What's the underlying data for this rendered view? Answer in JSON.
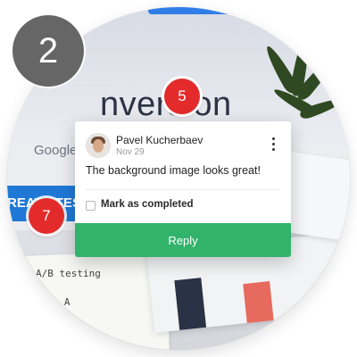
{
  "step_badge": "2",
  "markers": {
    "active": "5",
    "other": "7"
  },
  "background": {
    "headline": "nversion",
    "subtext": "Google Play.",
    "cta_fragment": "REATE TEST",
    "note_line1": "A/B testing",
    "note_line2": "ce A"
  },
  "comment_card": {
    "author": "Pavel Kucherbaev",
    "date": "Nov 29",
    "text": "The background image looks great!",
    "mark_completed_label": "Mark as completed",
    "reply_label": "Reply"
  },
  "colors": {
    "accent_green": "#31b36b",
    "marker_red": "#e32b2b",
    "step_gray": "#666666"
  },
  "icons": {
    "menu": "more-vertical-icon",
    "avatar": "user-avatar"
  }
}
